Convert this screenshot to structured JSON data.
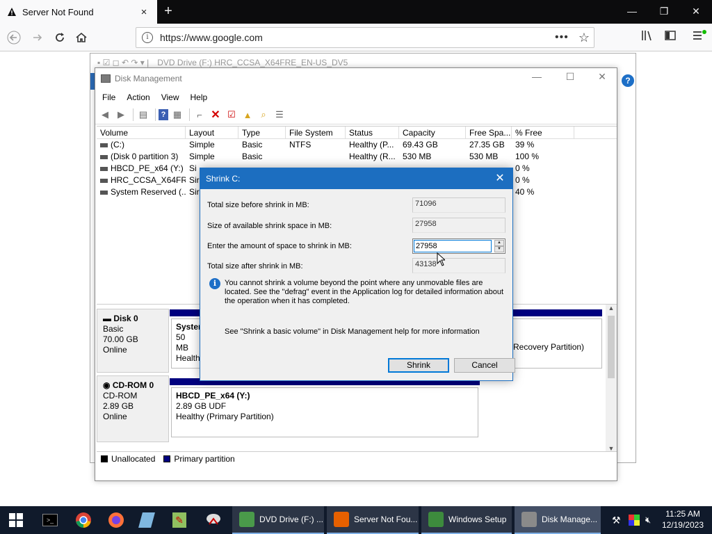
{
  "browser": {
    "tab_title": "Server Not Found",
    "url": "https://www.google.com",
    "new_tab_symbol": "+",
    "close_symbol": "×",
    "minimize_symbol": "—",
    "maximize_symbol": "❐",
    "window_close_symbol": "✕"
  },
  "bg_window": {
    "title": "DVD Drive (F:) HRC_CCSA_X64FRE_EN-US_DV5",
    "help_symbol": "?"
  },
  "disk_mgmt": {
    "title": "Disk Management",
    "menu": [
      "File",
      "Action",
      "View",
      "Help"
    ],
    "columns": [
      "Volume",
      "Layout",
      "Type",
      "File System",
      "Status",
      "Capacity",
      "Free Spa...",
      "% Free"
    ],
    "rows": [
      [
        "(C:)",
        "Simple",
        "Basic",
        "NTFS",
        "Healthy (P...",
        "69.43 GB",
        "27.35 GB",
        "39 %"
      ],
      [
        "(Disk 0 partition 3)",
        "Simple",
        "Basic",
        "",
        "Healthy (R...",
        "530 MB",
        "530 MB",
        "100 %"
      ],
      [
        "HBCD_PE_x64 (Y:)",
        "Si",
        "",
        "",
        "",
        "",
        "",
        "0 %"
      ],
      [
        "HRC_CCSA_X64FR...",
        "Sir",
        "",
        "",
        "",
        "",
        "",
        "0 %"
      ],
      [
        "System Reserved (...",
        "Sir",
        "",
        "",
        "",
        "",
        "",
        "40 %"
      ]
    ],
    "disk0": {
      "name": "Disk 0",
      "type": "Basic",
      "size": "70.00 GB",
      "state": "Online",
      "part1_name": "System",
      "part1_size": "50 MB",
      "part1_status": "Healthy",
      "part3_status": "Recovery Partition)"
    },
    "cdrom": {
      "name": "CD-ROM 0",
      "type": "CD-ROM",
      "size": "2.89 GB",
      "state": "Online",
      "part_name": "HBCD_PE_x64  (Y:)",
      "part_size": "2.89 GB UDF",
      "part_status": "Healthy (Primary Partition)"
    },
    "legend": {
      "unallocated": "Unallocated",
      "primary": "Primary partition"
    },
    "colors": {
      "primary": "#00007f",
      "unallocated": "#000000"
    }
  },
  "dialog": {
    "title": "Shrink C:",
    "close_symbol": "✕",
    "label_total_before": "Total size before shrink in MB:",
    "value_total_before": "71096",
    "label_available": "Size of available shrink space in MB:",
    "value_available": "27958",
    "label_enter": "Enter the amount of space to shrink in MB:",
    "value_enter": "27958",
    "label_total_after": "Total size after shrink in MB:",
    "value_total_after": "43138",
    "info_text": "You cannot shrink a volume beyond the point where any unmovable files are located. See the \"defrag\" event in the Application log for detailed information about the operation when it has completed.",
    "help_text": "See \"Shrink a basic volume\" in Disk Management help for more information",
    "shrink_button": "Shrink",
    "cancel_button": "Cancel"
  },
  "taskbar": {
    "apps": [
      {
        "label": "DVD Drive (F:) ...",
        "color": "#4a9a4a"
      },
      {
        "label": "Server Not Fou...",
        "color": "#e66000"
      },
      {
        "label": "Windows Setup",
        "color": "#3d8b3d"
      },
      {
        "label": "Disk Manage...",
        "color": "#8a8a8a"
      }
    ],
    "time": "11:25 AM",
    "date": "12/19/2023"
  }
}
